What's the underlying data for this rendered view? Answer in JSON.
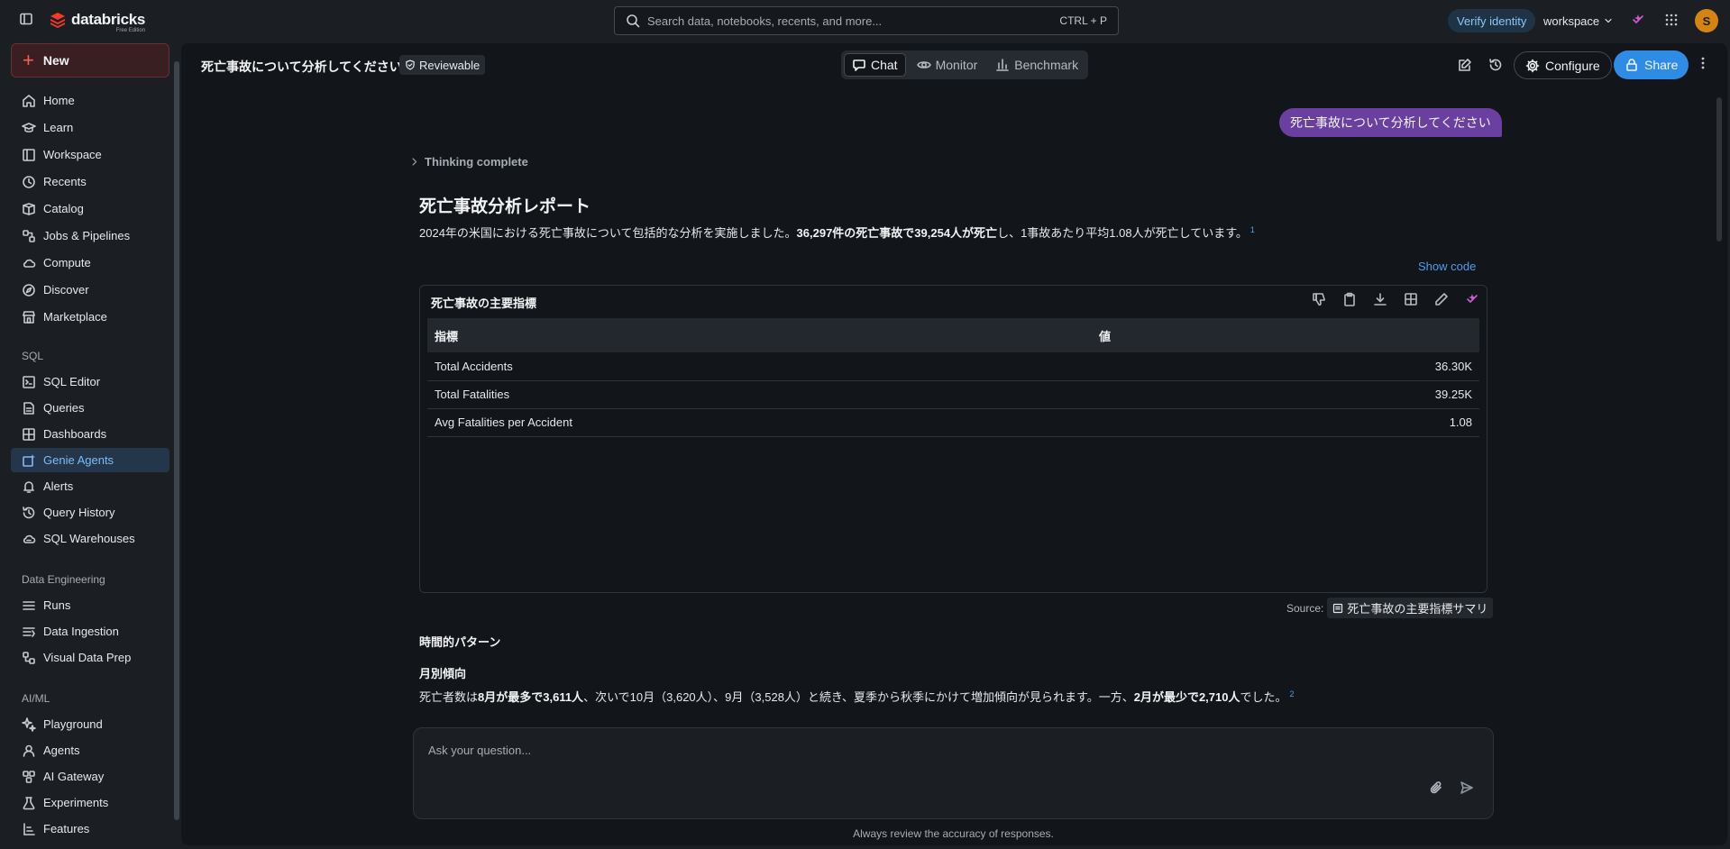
{
  "topbar": {
    "brand": "databricks",
    "edition": "Free Edition",
    "search_placeholder": "Search data, notebooks, recents, and more...",
    "search_shortcut": "CTRL + P",
    "verify_label": "Verify identity",
    "workspace_label": "workspace",
    "avatar_initial": "S",
    "avatar_color": "#d58412"
  },
  "sidebar": {
    "new_label": "New",
    "items": [
      {
        "label": "Home",
        "icon": "home-icon"
      },
      {
        "label": "Learn",
        "icon": "learn-icon"
      },
      {
        "label": "Workspace",
        "icon": "workspace-icon"
      },
      {
        "label": "Recents",
        "icon": "clock-icon"
      },
      {
        "label": "Catalog",
        "icon": "catalog-icon"
      },
      {
        "label": "Jobs & Pipelines",
        "icon": "jobs-icon"
      },
      {
        "label": "Compute",
        "icon": "cloud-icon"
      },
      {
        "label": "Discover",
        "icon": "compass-icon"
      },
      {
        "label": "Marketplace",
        "icon": "store-icon"
      }
    ],
    "sql_section": "SQL",
    "sql_items": [
      {
        "label": "SQL Editor",
        "icon": "sql-editor-icon"
      },
      {
        "label": "Queries",
        "icon": "queries-icon"
      },
      {
        "label": "Dashboards",
        "icon": "dashboard-icon"
      },
      {
        "label": "Genie Agents",
        "icon": "genie-icon",
        "active": true
      },
      {
        "label": "Alerts",
        "icon": "bell-icon"
      },
      {
        "label": "Query History",
        "icon": "history-icon"
      },
      {
        "label": "SQL Warehouses",
        "icon": "warehouse-icon"
      }
    ],
    "de_section": "Data Engineering",
    "de_items": [
      {
        "label": "Runs",
        "icon": "runs-icon"
      },
      {
        "label": "Data Ingestion",
        "icon": "ingestion-icon"
      },
      {
        "label": "Visual Data Prep",
        "icon": "data-prep-icon"
      }
    ],
    "ai_section": "AI/ML",
    "ai_items": [
      {
        "label": "Playground",
        "icon": "playground-icon"
      },
      {
        "label": "Agents",
        "icon": "agents-icon"
      },
      {
        "label": "AI Gateway",
        "icon": "gateway-icon"
      },
      {
        "label": "Experiments",
        "icon": "experiments-icon"
      },
      {
        "label": "Features",
        "icon": "features-icon"
      }
    ]
  },
  "header": {
    "title": "死亡事故について分析してください",
    "badge": "Reviewable",
    "tabs": [
      {
        "label": "Chat",
        "active": true
      },
      {
        "label": "Monitor"
      },
      {
        "label": "Benchmark"
      }
    ],
    "configure_label": "Configure",
    "share_label": "Share",
    "share_color": "#2f8ce6"
  },
  "chat": {
    "user_message": "死亡事故について分析してください",
    "thinking": "Thinking complete",
    "report_title": "死亡事故分析レポート",
    "para1": {
      "pre": "2024年の米国における死亡事故について包括的な分析を実施しました。",
      "bold": "36,297件の死亡事故で39,254人が死亡",
      "post": "し、1事故あたり平均1.08人が死亡しています。",
      "cite": "1"
    },
    "show_code": "Show code",
    "table": {
      "title": "死亡事故の主要指標",
      "headers": [
        "指標",
        "値"
      ],
      "rows": [
        [
          "Total Accidents",
          "36.30K"
        ],
        [
          "Total Fatalities",
          "39.25K"
        ],
        [
          "Avg Fatalities per Accident",
          "1.08"
        ]
      ]
    },
    "source_label": "Source:",
    "source_name": "死亡事故の主要指標サマリ",
    "section_time": "時間的パターン",
    "section_month": "月別傾向",
    "para2": {
      "p1": "死亡者数は",
      "b1": "8月が最多で3,611人",
      "p2": "、次いで10月（3,620人）、9月（3,528人）と続き、夏季から秋季にかけて増加傾向が見られます。一方、",
      "b2": "2月が最少で2,710人",
      "p3": "でした。",
      "cite": "2"
    }
  },
  "input": {
    "placeholder": "Ask your question...",
    "disclaimer": "Always review the accuracy of responses."
  }
}
